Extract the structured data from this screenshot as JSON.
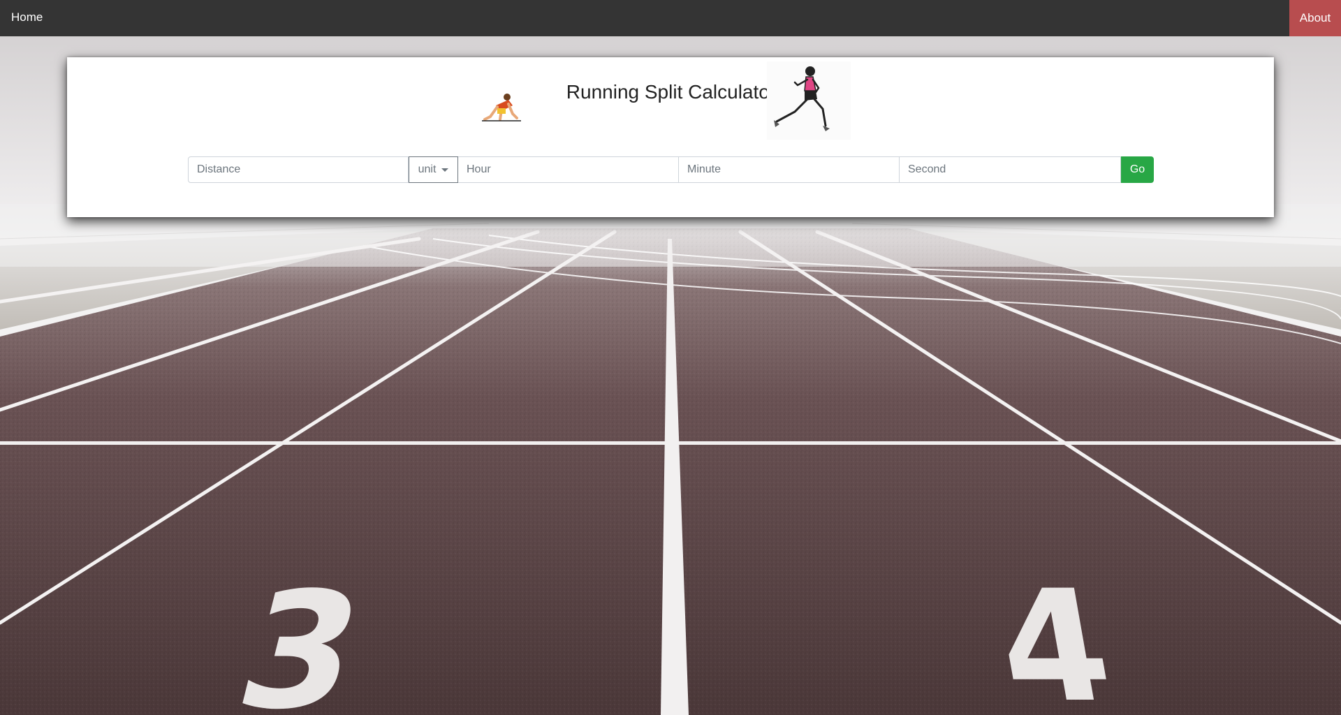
{
  "nav": {
    "home_label": "Home",
    "about_label": "About"
  },
  "header": {
    "title": "Running Split Calculator"
  },
  "form": {
    "distance_placeholder": "Distance",
    "unit_label": "unit",
    "hour_placeholder": "Hour",
    "minute_placeholder": "Minute",
    "second_placeholder": "Second",
    "go_label": "Go"
  },
  "track": {
    "lane_numbers": [
      "3",
      "4"
    ]
  },
  "colors": {
    "navbar": "#343434",
    "about_accent": "#b84d4f",
    "go_button": "#28a745",
    "track_surface": "#5a4446"
  }
}
